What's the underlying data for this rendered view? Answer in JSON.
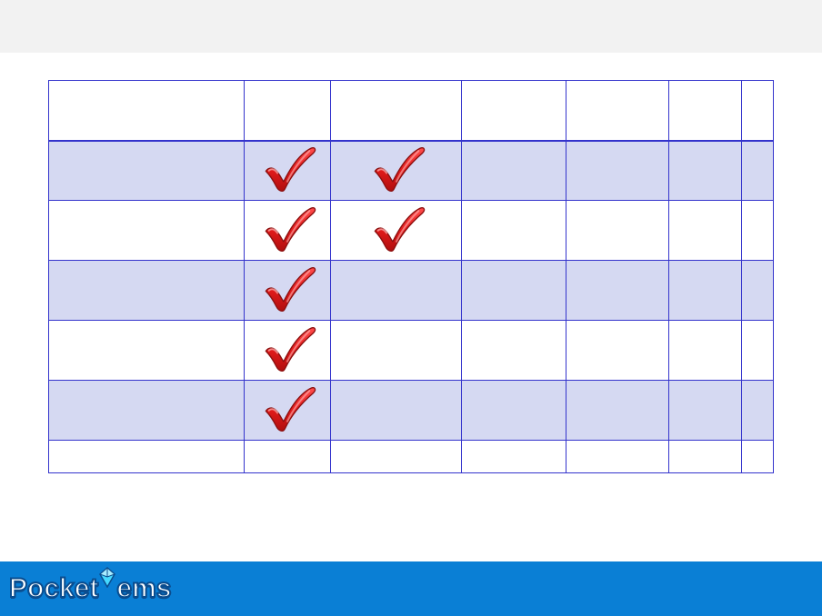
{
  "table": {
    "columns": [
      "",
      "",
      "",
      "",
      "",
      "",
      ""
    ],
    "rows": [
      {
        "alt": true,
        "cells": [
          "",
          "check",
          "check",
          "",
          "",
          "",
          ""
        ]
      },
      {
        "alt": false,
        "cells": [
          "",
          "check",
          "check",
          "",
          "",
          "",
          ""
        ]
      },
      {
        "alt": true,
        "cells": [
          "",
          "check",
          "",
          "",
          "",
          "",
          ""
        ]
      },
      {
        "alt": false,
        "cells": [
          "",
          "check",
          "",
          "",
          "",
          "",
          ""
        ]
      },
      {
        "alt": true,
        "cells": [
          "",
          "check",
          "",
          "",
          "",
          "",
          ""
        ]
      }
    ],
    "footer_cells": [
      "",
      "",
      "",
      "",
      "",
      "",
      ""
    ]
  },
  "brand": {
    "part1": "Pocket",
    "part2": "ems"
  },
  "icons": {
    "check": "check-icon",
    "gem": "gem-icon"
  },
  "colors": {
    "grid_border": "#3333cc",
    "row_alt": "#d5d9f2",
    "footer_bg": "#0a7fd5",
    "check_fill": "#e21b1b",
    "check_stroke": "#8a0f0f"
  }
}
